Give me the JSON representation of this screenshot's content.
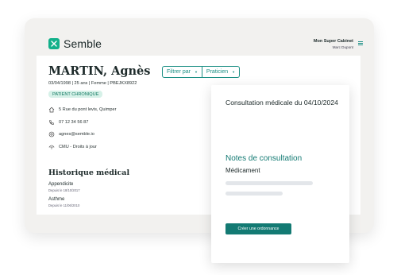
{
  "app": {
    "logo_text": "Semble",
    "cabinet_name": "Mon Super Cabinet",
    "user_name": "Marc Dupont",
    "accent": "#12b08a"
  },
  "patient": {
    "name": "MARTIN, Agnès",
    "meta": "03/04/1998  |  25 ans  |  Femme  |  PBEJKX8922",
    "badge": "PATIENT CHRONIQUE",
    "address": "5 Rue du pont levis, Quimper",
    "phone": "07 12 34 56 87",
    "email": "agnes@semble.io",
    "insurance": "CMU - Droits à jour"
  },
  "filters": {
    "filter_label": "Filtrer par",
    "practitioner_label": "Praticien"
  },
  "history": {
    "title": "Historique médical",
    "items": [
      {
        "name": "Appendicite",
        "date": "Depuis le 18/10/2017"
      },
      {
        "name": "Asthme",
        "date": "Depuis le 11/06/2010"
      }
    ]
  },
  "consultation": {
    "title": "Consultation médicale du 04/10/2024",
    "notes_label": "Notes de consultation",
    "medication_label": "Médicament",
    "button_label": "Créer une ordonnance"
  }
}
